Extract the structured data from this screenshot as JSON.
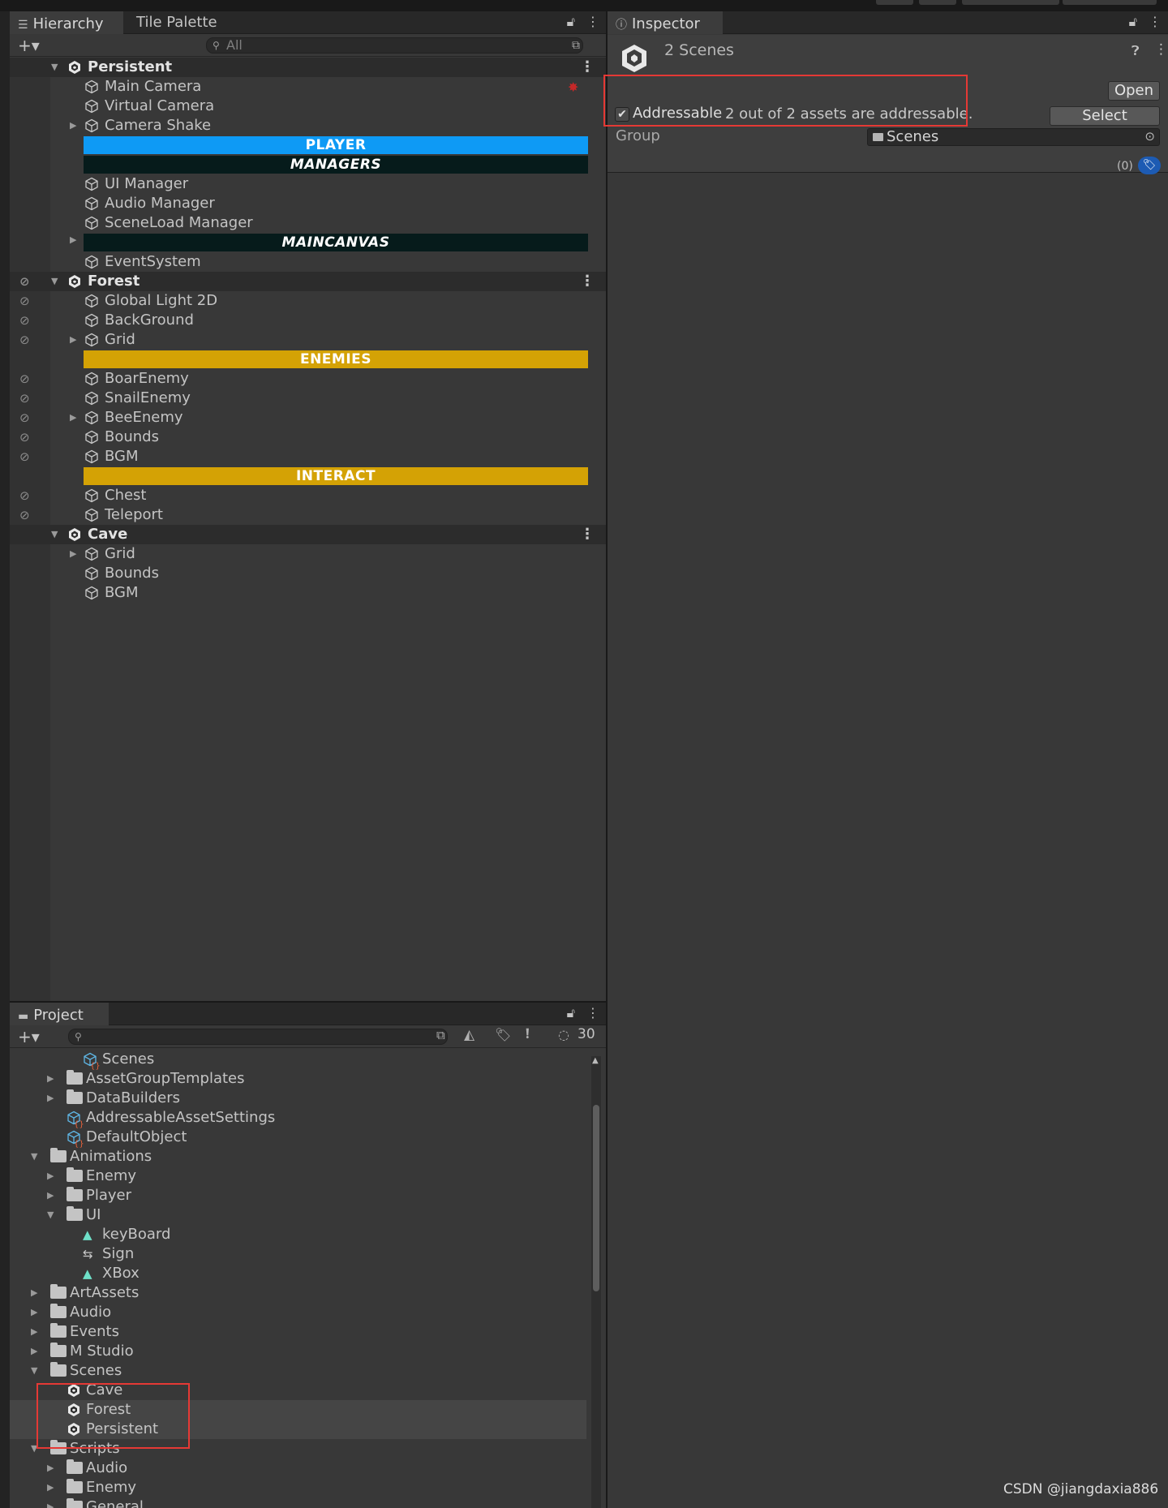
{
  "hierarchy": {
    "tab_label": "Hierarchy",
    "second_tab_label": "Tile Palette",
    "search_placeholder": "All",
    "rows": [
      {
        "label": "Persistent",
        "type": "scene"
      },
      {
        "label": "Main Camera"
      },
      {
        "label": "Virtual Camera"
      },
      {
        "label": "Camera Shake"
      },
      {
        "label": "PLAYER",
        "type": "header",
        "color": "#0e9af5"
      },
      {
        "label": "MANAGERS",
        "type": "header",
        "color": "#061b1b"
      },
      {
        "label": "UI Manager"
      },
      {
        "label": "Audio Manager"
      },
      {
        "label": "SceneLoad Manager"
      },
      {
        "label": "MAINCANVAS",
        "type": "header",
        "color": "#061b1b"
      },
      {
        "label": "EventSystem"
      },
      {
        "label": "Forest",
        "type": "scene"
      },
      {
        "label": "Global Light 2D"
      },
      {
        "label": "BackGround"
      },
      {
        "label": "Grid"
      },
      {
        "label": "ENEMIES",
        "type": "header",
        "color": "#d4a205"
      },
      {
        "label": "BoarEnemy"
      },
      {
        "label": "SnailEnemy"
      },
      {
        "label": "BeeEnemy"
      },
      {
        "label": "Bounds"
      },
      {
        "label": "BGM"
      },
      {
        "label": "INTERACT",
        "type": "header",
        "color": "#d4a205"
      },
      {
        "label": "Chest"
      },
      {
        "label": "Teleport"
      },
      {
        "label": "Cave",
        "type": "scene"
      },
      {
        "label": "Grid"
      },
      {
        "label": "Bounds"
      },
      {
        "label": "BGM"
      }
    ]
  },
  "inspector": {
    "tab_label": "Inspector",
    "title": "2 Scenes",
    "open_label": "Open",
    "select_label": "Select",
    "addressable_label": "Addressable",
    "addressable_status": "2 out of 2 assets are addressable.",
    "group_label": "Group",
    "group_value": "Scenes",
    "label_count": "(0)"
  },
  "project": {
    "tab_label": "Project",
    "hidden_count": "30",
    "rows": [
      {
        "label": "Scenes",
        "kind": "asset"
      },
      {
        "label": "AssetGroupTemplates",
        "kind": "folder"
      },
      {
        "label": "DataBuilders",
        "kind": "folder"
      },
      {
        "label": "AddressableAssetSettings",
        "kind": "asset"
      },
      {
        "label": "DefaultObject",
        "kind": "asset"
      },
      {
        "label": "Animations",
        "kind": "folder"
      },
      {
        "label": "Enemy",
        "kind": "folder"
      },
      {
        "label": "Player",
        "kind": "folder"
      },
      {
        "label": "UI",
        "kind": "folder"
      },
      {
        "label": "keyBoard",
        "kind": "anim"
      },
      {
        "label": "Sign",
        "kind": "controller"
      },
      {
        "label": "XBox",
        "kind": "anim"
      },
      {
        "label": "ArtAssets",
        "kind": "folder"
      },
      {
        "label": "Audio",
        "kind": "folder"
      },
      {
        "label": "Events",
        "kind": "folder"
      },
      {
        "label": "M Studio",
        "kind": "folder"
      },
      {
        "label": "Scenes",
        "kind": "folder"
      },
      {
        "label": "Cave",
        "kind": "scene"
      },
      {
        "label": "Forest",
        "kind": "scene"
      },
      {
        "label": "Persistent",
        "kind": "scene"
      },
      {
        "label": "Scripts",
        "kind": "folder"
      },
      {
        "label": "Audio",
        "kind": "folder"
      },
      {
        "label": "Enemy",
        "kind": "folder"
      },
      {
        "label": "General",
        "kind": "folder"
      }
    ]
  },
  "watermark": "CSDN @jiangdaxia886"
}
